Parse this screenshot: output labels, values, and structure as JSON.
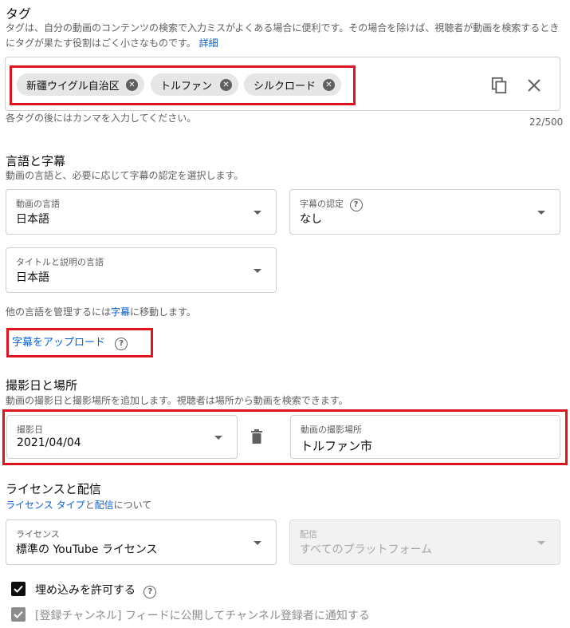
{
  "tags": {
    "heading": "タグ",
    "description": "タグは、自分の動画のコンテンツの検索で入力ミスがよくある場合に便利です。その場合を除けば、視聴者が動画を検索するときにタグが果たす役割はごく小さなものです。",
    "details_link": "詳細",
    "items": [
      "新疆ウイグル自治区",
      "トルファン",
      "シルクロード"
    ],
    "hint": "各タグの後にはカンマを入力してください。",
    "counter": "22/500"
  },
  "language": {
    "heading": "言語と字幕",
    "description": "動画の言語と、必要に応じて字幕の認定を選択します。",
    "video_language_label": "動画の言語",
    "video_language_value": "日本語",
    "caption_cert_label": "字幕の認定",
    "caption_cert_value": "なし",
    "title_language_label": "タイトルと説明の言語",
    "title_language_value": "日本語",
    "manage_text_before": "他の言語を管理するには",
    "manage_link": "字幕",
    "manage_text_after": "に移動します。",
    "upload_subtitles": "字幕をアップロード"
  },
  "recording": {
    "heading": "撮影日と場所",
    "description": "動画の撮影日と撮影場所を追加します。視聴者は場所から動画を検索できます。",
    "date_label": "撮影日",
    "date_value": "2021/04/04",
    "location_label": "動画の撮影場所",
    "location_value": "トルファン市"
  },
  "license": {
    "heading": "ライセンスと配信",
    "license_type_link": "ライセンス タイプ",
    "and": "と",
    "distribution_link": "配信",
    "about": "について",
    "license_label": "ライセンス",
    "license_value": "標準の YouTube ライセンス",
    "distribution_label": "配信",
    "distribution_value": "すべてのプラットフォーム"
  },
  "options": {
    "allow_embedding": "埋め込みを許可する",
    "publish_feed": "[登録チャンネル] フィードに公開してチャンネル登録者に通知する"
  },
  "colors": {
    "accent_link": "#065fd4",
    "highlight": "#e0141e"
  }
}
